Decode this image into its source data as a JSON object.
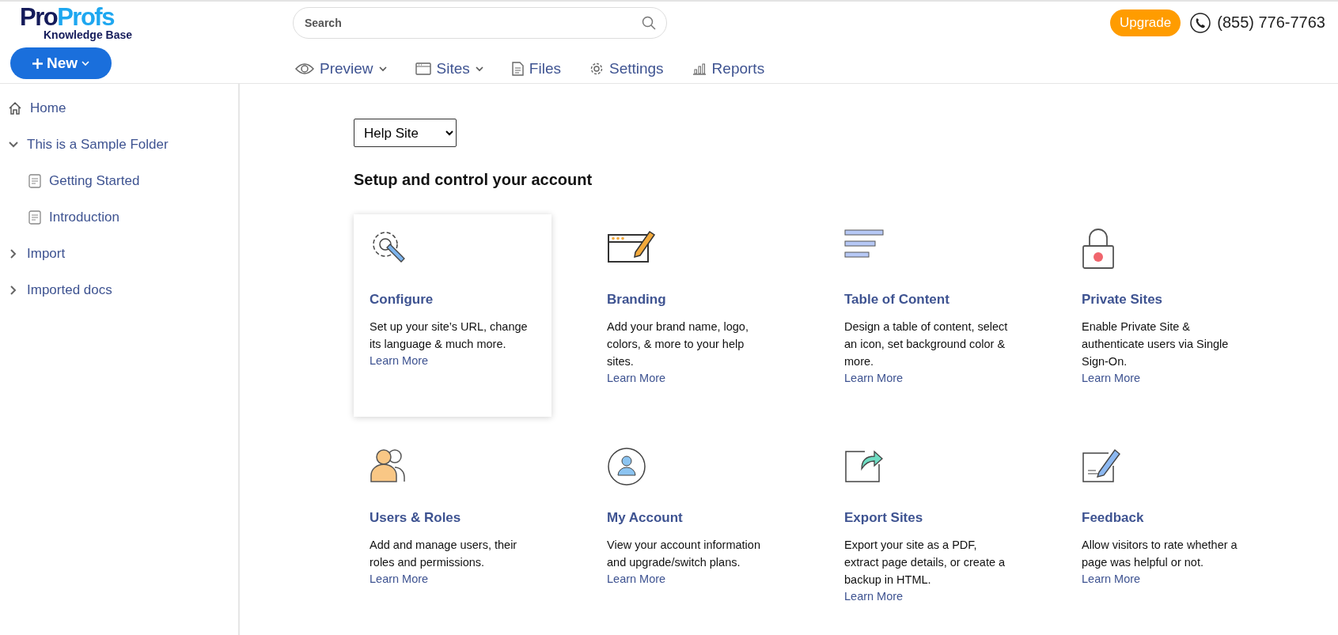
{
  "logo": {
    "brand_first": "Pro",
    "brand_second": "Profs",
    "product": "Knowledge Base"
  },
  "search": {
    "placeholder": "Search"
  },
  "upgrade_button": "Upgrade",
  "phone": "(855) 776-7763",
  "new_button": "New",
  "nav": [
    {
      "label": "Preview",
      "dropdown": true
    },
    {
      "label": "Sites",
      "dropdown": true
    },
    {
      "label": "Files",
      "dropdown": false
    },
    {
      "label": "Settings",
      "dropdown": false
    },
    {
      "label": "Reports",
      "dropdown": false
    }
  ],
  "sidebar": {
    "items": [
      {
        "kind": "home",
        "label": "Home"
      },
      {
        "kind": "folder",
        "label": "This is a Sample Folder",
        "expanded": true,
        "children": [
          {
            "kind": "page",
            "label": "Getting Started"
          },
          {
            "kind": "page",
            "label": "Introduction"
          }
        ]
      },
      {
        "kind": "folder",
        "label": "Import",
        "expanded": false
      },
      {
        "kind": "folder",
        "label": "Imported docs",
        "expanded": false
      }
    ]
  },
  "site_select": "Help Site",
  "heading": "Setup and control your account",
  "cards": [
    {
      "title": "Configure",
      "description": "Set up your site’s URL, change its language & much more.",
      "link": "Learn More",
      "selected": true
    },
    {
      "title": "Branding",
      "description": "Add your brand name, logo, colors, & more to your help sites.",
      "link": "Learn More",
      "selected": false
    },
    {
      "title": "Table of Content",
      "description": "Design a table of content, select an icon, set background color & more.",
      "link": "Learn More",
      "selected": false
    },
    {
      "title": "Private Sites",
      "description": "Enable Private Site & authenticate users via Single Sign-On.",
      "link": "Learn More",
      "selected": false
    },
    {
      "title": "Users & Roles",
      "description": "Add and manage users, their roles and permissions.",
      "link": "Learn More",
      "selected": false
    },
    {
      "title": "My Account",
      "description": "View your account information and upgrade/switch plans.",
      "link": "Learn More",
      "selected": false
    },
    {
      "title": "Export Sites",
      "description": "Export your site as a PDF, extract page details, or create a backup in HTML.",
      "link": "Learn More",
      "selected": false
    },
    {
      "title": "Feedback",
      "description": "Allow visitors to rate whether a page was helpful or not.",
      "link": "Learn More",
      "selected": false
    }
  ]
}
